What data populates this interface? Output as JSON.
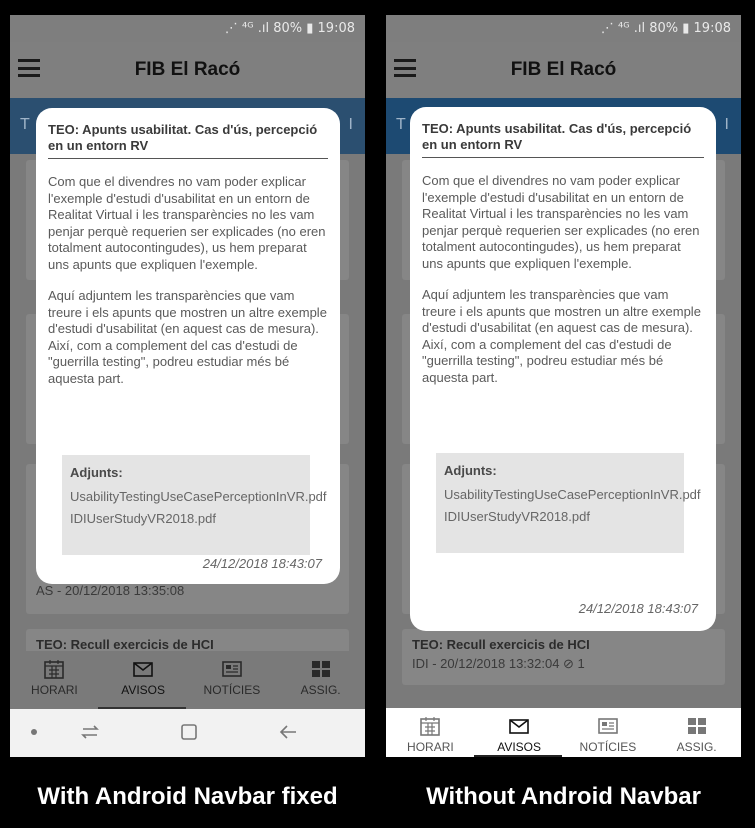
{
  "status": {
    "text": "⋰ ⁴ᴳ .ıl 80% ▮ 19:08"
  },
  "app": {
    "title": "FIB  El Racó",
    "tab_left": "T",
    "tab_right": "I"
  },
  "dialog": {
    "title": "TEO: Apunts usabilitat. Cas d'ús, percepció en un entorn RV",
    "para1": "Com que el divendres no vam poder explicar l'exemple d'estudi d'usabilitat en un entorn de Realitat Virtual i les transparències no les vam penjar perquè requerien ser explicades (no eren totalment autocontingudes), us hem preparat uns apunts que expliquen l'exemple.",
    "para2": "Aquí adjuntem les transparències que vam treure i els apunts que mostren un altre exemple d'estudi d'usabilitat (en aquest cas de mesura). Així, com a complement del cas d'estudi de \"guerrilla testing\", podreu estudiar més bé aquesta part.",
    "attach_heading": "Adjunts:",
    "attachments": [
      "UsabilityTestingUseCasePerceptionInVR.pdf",
      "IDIUserStudyVR2018.pdf"
    ],
    "date": "24/12/2018 18:43:07"
  },
  "left_bg": {
    "meta1": "AS - 20/12/2018 13:35:08",
    "title2": "TEO: Recull exercicis de HCI"
  },
  "right_bg": {
    "title2": "TEO: Recull exercicis de HCI",
    "meta2": "IDI - 20/12/2018 13:32:04  ⊘ 1"
  },
  "nav": {
    "items": [
      "HORARI",
      "AVISOS",
      "NOTÍCIES",
      "ASSIG."
    ]
  },
  "captions": {
    "left": "With Android Navbar fixed",
    "right": "Without Android Navbar"
  },
  "colors": {
    "accent_blue": "#1d4a72",
    "dim_overlay": "#7a7a7a"
  }
}
